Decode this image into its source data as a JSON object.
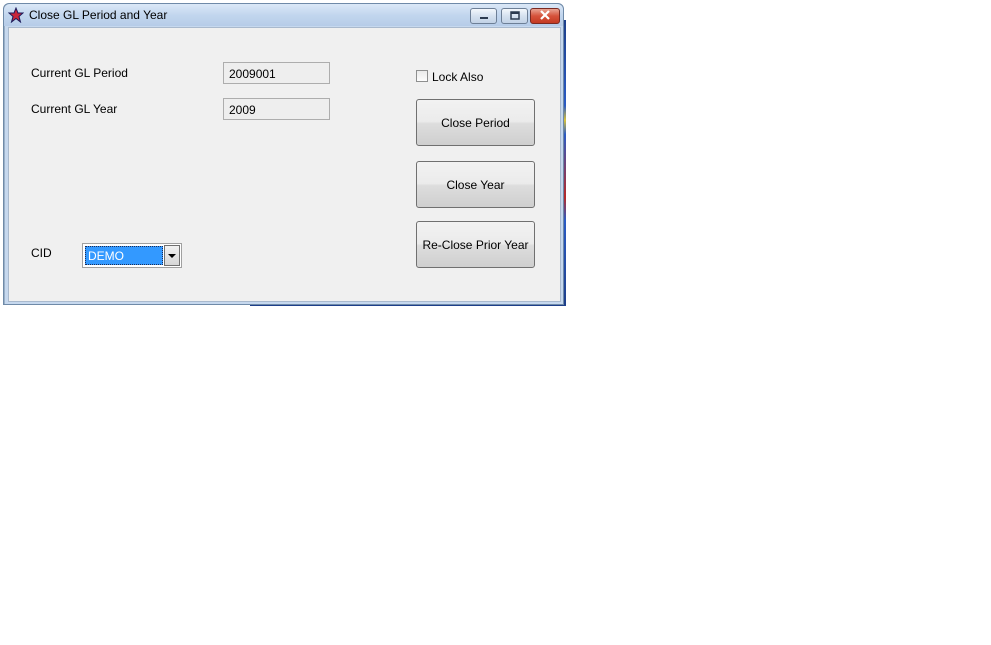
{
  "window": {
    "title": "Close GL Period and Year",
    "icon": "star-icon"
  },
  "form": {
    "period_label": "Current GL Period",
    "period_value": "2009001",
    "year_label": "Current GL Year",
    "year_value": "2009",
    "lock_also_label": "Lock Also",
    "lock_also_checked": false,
    "cid_label": "CID",
    "cid_value": "DEMO"
  },
  "buttons": {
    "close_period": "Close Period",
    "close_year": "Close Year",
    "reclose_prior_year": "Re-Close Prior Year"
  },
  "colors": {
    "selection": "#3399ff",
    "close_button": "#c43a22"
  }
}
